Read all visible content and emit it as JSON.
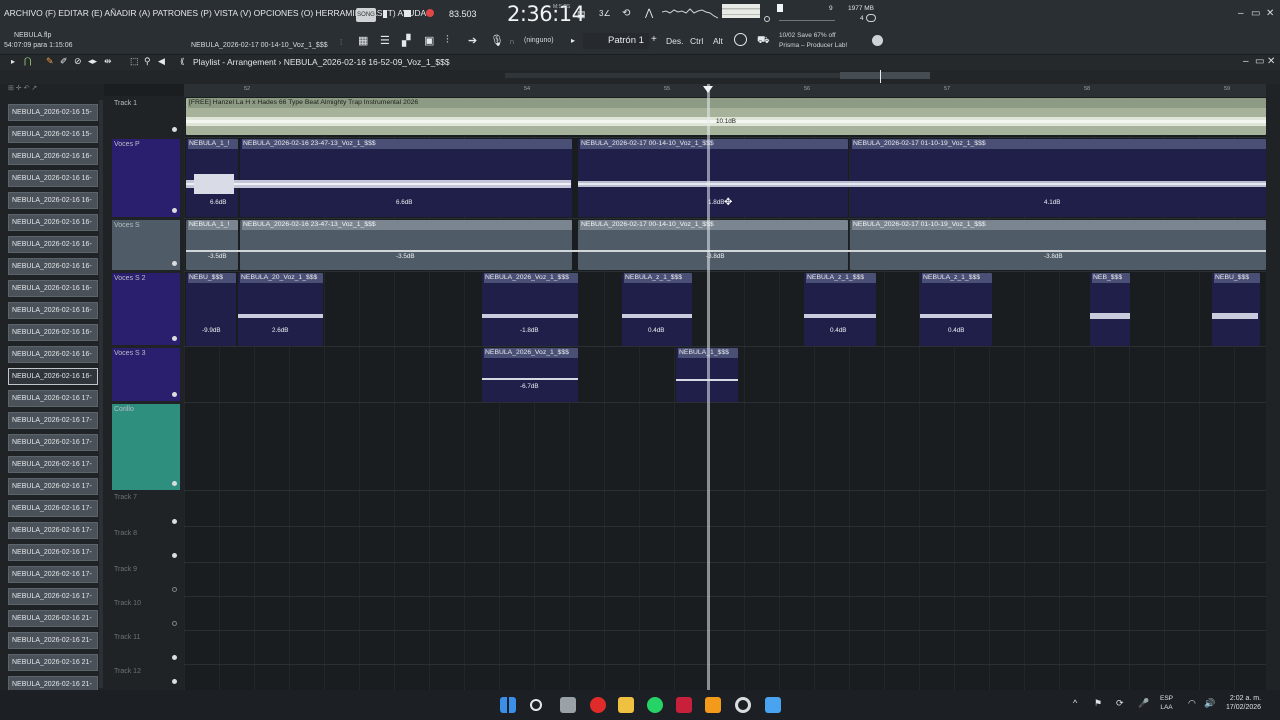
{
  "menu": {
    "text": "ARCHIVO (F) EDITAR (E) AÑADIR (A) PATRONES (P) VISTA (V) OPCIONES (O) HERRAMIENTAS (T) AYUDA",
    "song_badge": "SONG"
  },
  "transport": {
    "tempo": "83.503",
    "clock": "2:36:14",
    "clock_sub": "M:S:CS",
    "cpu_num": "9",
    "mem": "1977 MB",
    "voices": "4"
  },
  "info": {
    "project_file": "NEBULA.flp",
    "time_position": "54:07:09 para 1:15:06",
    "hint_file": "NEBULA_2026-02-17 00-14-10_Voz_1_$$$",
    "ninguno": "(ninguno)",
    "pattern": "Patrón 1",
    "des": "Des.",
    "ctrl": "Ctrl",
    "alt": "Alt",
    "news_line1": "10/02  Save 67% off",
    "news_line2": "Prisma – Producer Lab!"
  },
  "playlist": {
    "title": "Playlist - Arrangement › NEBULA_2026-02-16 16-52-09_Voz_1_$$$",
    "ruler": [
      "52",
      "54",
      "55",
      "56",
      "57",
      "58",
      "59"
    ]
  },
  "browser": {
    "items": [
      "NEBULA_2026-02-16 15-",
      "NEBULA_2026-02-16 15-",
      "NEBULA_2026-02-16 16-",
      "NEBULA_2026-02-16 16-",
      "NEBULA_2026-02-16 16-",
      "NEBULA_2026-02-16 16-",
      "NEBULA_2026-02-16 16-",
      "NEBULA_2026-02-16 16-",
      "NEBULA_2026-02-16 16-",
      "NEBULA_2026-02-16 16-",
      "NEBULA_2026-02-16 16-",
      "NEBULA_2026-02-16 16-",
      "NEBULA_2026-02-16 16-",
      "NEBULA_2026-02-16 17-",
      "NEBULA_2026-02-16 17-",
      "NEBULA_2026-02-16 17-",
      "NEBULA_2026-02-16 17-",
      "NEBULA_2026-02-16 17-",
      "NEBULA_2026-02-16 17-",
      "NEBULA_2026-02-16 17-",
      "NEBULA_2026-02-16 17-",
      "NEBULA_2026-02-16 17-",
      "NEBULA_2026-02-16 17-",
      "NEBULA_2026-02-16 21-",
      "NEBULA_2026-02-16 21-",
      "NEBULA_2026-02-16 21-",
      "NEBULA_2026-02-16 21-"
    ],
    "selected_index": 12
  },
  "tracks": [
    {
      "name": "Track 1"
    },
    {
      "name": "Voces P"
    },
    {
      "name": "Voces S"
    },
    {
      "name": "Voces S 2"
    },
    {
      "name": "Voces S 3"
    },
    {
      "name": "Corillo"
    },
    {
      "name": "Track 7"
    },
    {
      "name": "Track 8"
    },
    {
      "name": "Track 9"
    },
    {
      "name": "Track 10"
    },
    {
      "name": "Track 11"
    },
    {
      "name": "Track 12"
    }
  ],
  "clips": {
    "beat": {
      "title": "[FREE] Hanzel La H x Hades 66 Type Beat Almighty  Trap Instrumental 2026",
      "db": "10.1dB"
    },
    "vp1": {
      "title": "NEBULA_1_!",
      "db": "6.6dB"
    },
    "vp2": {
      "title": "NEBULA_2026-02-16 23-47-13_Voz_1_$$$",
      "db": "6.6dB"
    },
    "vp3": {
      "title": "NEBULA_2026-02-17 00-14-10_Voz_1_$$$",
      "db": "1.8dB"
    },
    "vp4": {
      "title": "NEBULA_2026-02-17 01-10-19_Voz_1_$$$",
      "db": "4.1dB"
    },
    "vs1": {
      "title": "NEBULA_1_!",
      "db": "-3.5dB"
    },
    "vs2": {
      "title": "NEBULA_2026-02-16 23-47-13_Voz_1_$$$",
      "db": "-3.5dB"
    },
    "vs3": {
      "title": "NEBULA_2026-02-17 00-14-10_Voz_1_$$$",
      "db": "-3.8dB"
    },
    "vs4": {
      "title": "NEBULA_2026-02-17 01-10-19_Voz_1_$$$",
      "db": "-3.8dB"
    },
    "v2a": {
      "title": "NEBU_$$$",
      "db": "-9.9dB"
    },
    "v2b": {
      "title": "NEBULA_20_Voz_1_$$$",
      "db": "2.6dB"
    },
    "v2c": {
      "title": "NEBULA_2026_Voz_1_$$$",
      "db": "-1.8dB"
    },
    "v2d": {
      "title": "NEBULA_z_1_$$$",
      "db": "0.4dB"
    },
    "v2e": {
      "title": "NEBULA_z_1_$$$",
      "db": "0.4dB"
    },
    "v2f": {
      "title": "NEBULA_z_1_$$$",
      "db": "0.4dB"
    },
    "v2g": {
      "title": "NEB_$$$",
      "db": ""
    },
    "v2h": {
      "title": "NEBU_$$$",
      "db": ""
    },
    "v3a": {
      "title": "NEBULA_2026_Voz_1_$$$",
      "db": "-6.7dB"
    },
    "v3b": {
      "title": "NEBULA_1_$$$",
      "db": ""
    }
  },
  "tray": {
    "lang1": "ESP",
    "lang2": "LAA",
    "time": "2:02 a. m.",
    "date": "17/02/2026"
  },
  "colors": {
    "accent_purple": "#6a55ff",
    "clip_purple": "#1f1f4a",
    "clip_green": "#a6b29a",
    "corillo_teal": "#2f8f7f"
  }
}
